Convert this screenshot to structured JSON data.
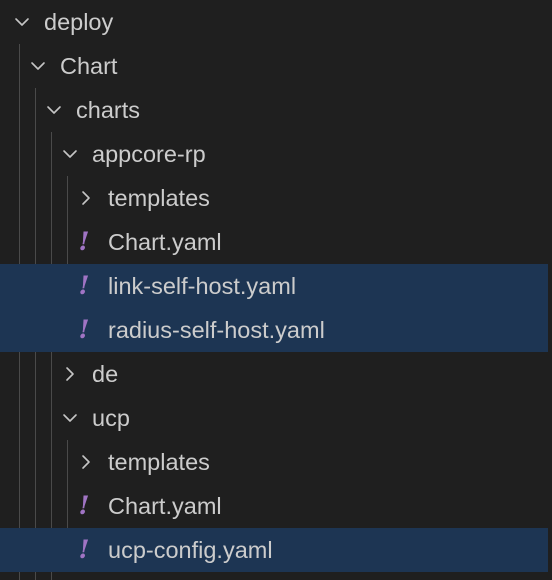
{
  "explorer": {
    "tree": [
      {
        "label": "deploy",
        "kind": "folder",
        "expanded": true,
        "depth": 0
      },
      {
        "label": "Chart",
        "kind": "folder",
        "expanded": true,
        "depth": 1
      },
      {
        "label": "charts",
        "kind": "folder",
        "expanded": true,
        "depth": 2
      },
      {
        "label": "appcore-rp",
        "kind": "folder",
        "expanded": true,
        "depth": 3
      },
      {
        "label": "templates",
        "kind": "folder",
        "expanded": false,
        "depth": 4
      },
      {
        "label": "Chart.yaml",
        "kind": "yaml",
        "depth": 4
      },
      {
        "label": "link-self-host.yaml",
        "kind": "yaml",
        "depth": 4,
        "selected": true
      },
      {
        "label": "radius-self-host.yaml",
        "kind": "yaml",
        "depth": 4,
        "selected": true
      },
      {
        "label": "de",
        "kind": "folder",
        "expanded": false,
        "depth": 3
      },
      {
        "label": "ucp",
        "kind": "folder",
        "expanded": true,
        "depth": 3
      },
      {
        "label": "templates",
        "kind": "folder",
        "expanded": false,
        "depth": 4
      },
      {
        "label": "Chart.yaml",
        "kind": "yaml",
        "depth": 4
      },
      {
        "label": "ucp-config.yaml",
        "kind": "yaml",
        "depth": 4,
        "selected": true
      }
    ],
    "yaml_icon_glyph": "!",
    "colors": {
      "background": "#1f1f1f",
      "selection": "#1d3553",
      "text": "#cccccc",
      "yaml_icon": "#a074c4",
      "indent_guide": "#4a4a4a"
    }
  }
}
